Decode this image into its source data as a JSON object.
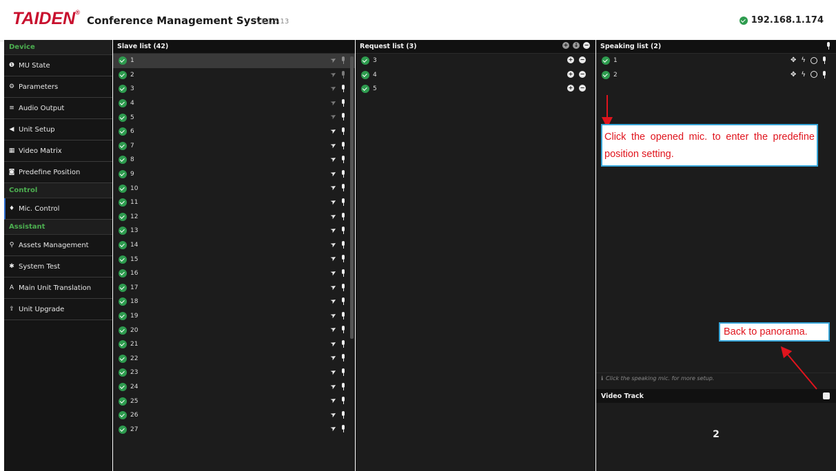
{
  "header": {
    "logo_text": "TAIDEN",
    "logo_mark": "®",
    "title": "Conference Management System",
    "version": "v1.1.5.13",
    "ip": "192.168.1.174"
  },
  "sidebar": {
    "section_device": "Device",
    "section_control": "Control",
    "section_assistant": "Assistant",
    "device_items": [
      {
        "label": "MU State",
        "icon": "info-icon"
      },
      {
        "label": "Parameters",
        "icon": "cogs-icon"
      },
      {
        "label": "Audio Output",
        "icon": "sliders-icon"
      },
      {
        "label": "Unit Setup",
        "icon": "volume-icon"
      },
      {
        "label": "Video Matrix",
        "icon": "grid-icon"
      },
      {
        "label": "Predefine Position",
        "icon": "camera-icon"
      }
    ],
    "control_items": [
      {
        "label": "Mic. Control",
        "icon": "mic-icon"
      }
    ],
    "assistant_items": [
      {
        "label": "Assets Management",
        "icon": "map-marker-icon"
      },
      {
        "label": "System Test",
        "icon": "bug-icon"
      },
      {
        "label": "Main Unit Translation",
        "icon": "font-icon"
      },
      {
        "label": "Unit Upgrade",
        "icon": "upload-icon"
      }
    ]
  },
  "slave_list": {
    "title": "Slave list (42)",
    "units": [
      "1",
      "2",
      "3",
      "4",
      "5",
      "6",
      "7",
      "8",
      "9",
      "10",
      "11",
      "12",
      "13",
      "14",
      "15",
      "16",
      "17",
      "18",
      "19",
      "20",
      "21",
      "22",
      "23",
      "24",
      "25",
      "26",
      "27"
    ]
  },
  "request_list": {
    "title": "Request list (3)",
    "units": [
      "3",
      "4",
      "5"
    ]
  },
  "speaking_list": {
    "title": "Speaking list (2)",
    "units": [
      "1",
      "2"
    ]
  },
  "hint": "Click the speaking mic. for more setup.",
  "video_track": {
    "title": "Video Track",
    "value": "2"
  },
  "annotations": {
    "predefine": "Click the opened mic. to enter the predefine position setting.",
    "panorama": "Back to panorama."
  },
  "colors": {
    "brand_red": "#c8102e",
    "ok_green": "#2e9c4f",
    "annotation_red": "#e0141d",
    "annotation_border": "#37a6d9"
  }
}
